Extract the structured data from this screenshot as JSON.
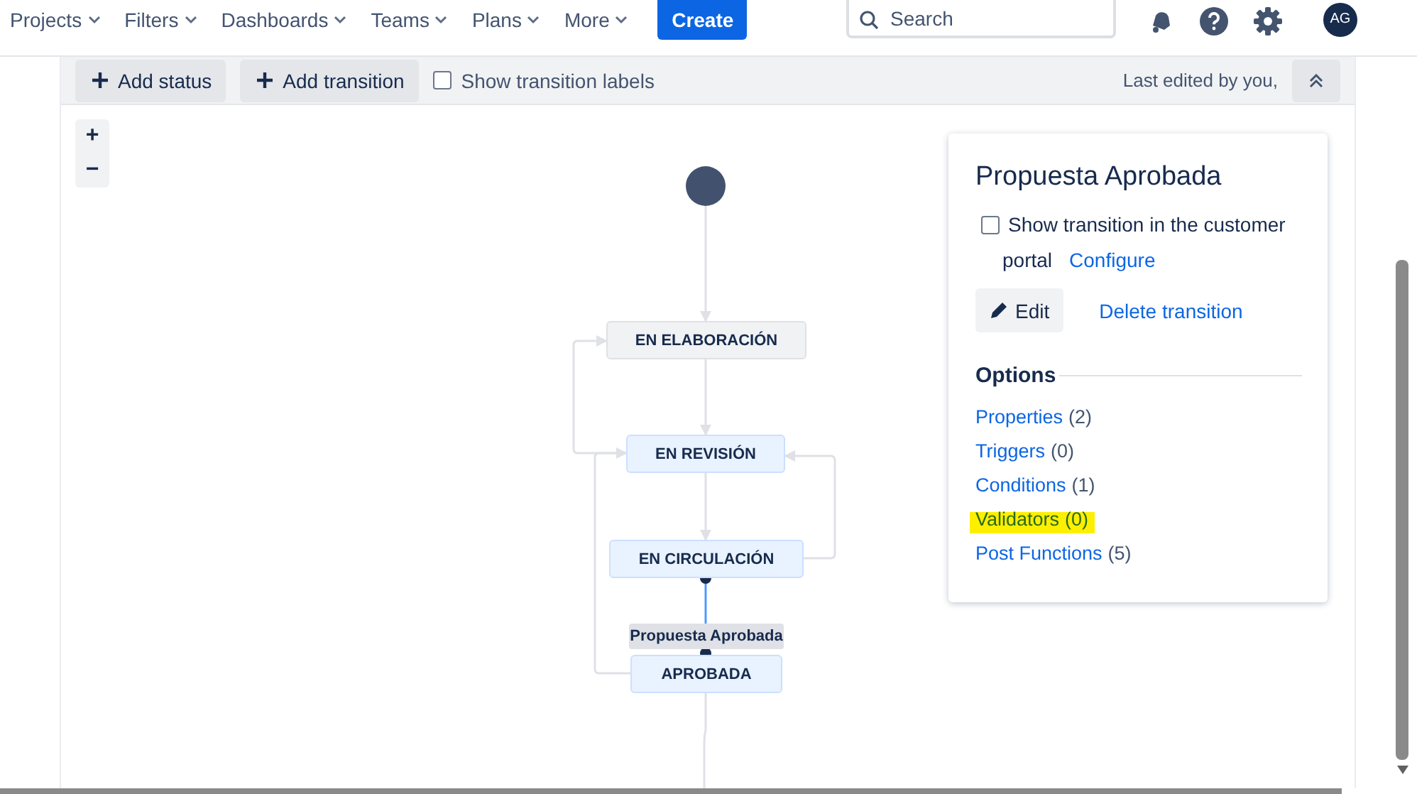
{
  "nav": {
    "items": [
      {
        "label": "Projects"
      },
      {
        "label": "Filters"
      },
      {
        "label": "Dashboards"
      },
      {
        "label": "Teams"
      },
      {
        "label": "Plans"
      },
      {
        "label": "More"
      }
    ],
    "create_button": "Create",
    "search": {
      "placeholder": "Search"
    },
    "avatar": "AG"
  },
  "toolbar": {
    "buttons": [
      "Add status",
      "Add transition"
    ],
    "show_labels": {
      "label": "Show transition labels",
      "checked": false
    },
    "last_edited": "Last edited by you,"
  },
  "zoom_controls": [
    "+",
    "−"
  ],
  "diagram": {
    "statuses": [
      {
        "label": "EN ELABORACIÓN",
        "kind": "todo"
      },
      {
        "label": "EN REVISIÓN",
        "kind": "inprogress"
      },
      {
        "label": "EN CIRCULACIÓN",
        "kind": "inprogress"
      },
      {
        "label": "APROBADA",
        "kind": "inprogress"
      }
    ],
    "selected_transition": "Propuesta Aprobada"
  },
  "panel": {
    "title": "Propuesta Aprobada",
    "portal_checkbox": {
      "label": "Show transition in the customer",
      "label_cont": "portal",
      "checked": false
    },
    "configure_link": "Configure",
    "edit_button": "Edit",
    "delete_link": "Delete transition",
    "options_heading": "Options",
    "options": [
      {
        "label": "Properties",
        "count": "(2)",
        "highlighted": false
      },
      {
        "label": "Triggers",
        "count": "(0)",
        "highlighted": false
      },
      {
        "label": "Conditions",
        "count": "(1)",
        "highlighted": false
      },
      {
        "label": "Validators",
        "count": "(0)",
        "highlighted": true
      },
      {
        "label": "Post Functions",
        "count": "(5)",
        "highlighted": false
      }
    ]
  }
}
